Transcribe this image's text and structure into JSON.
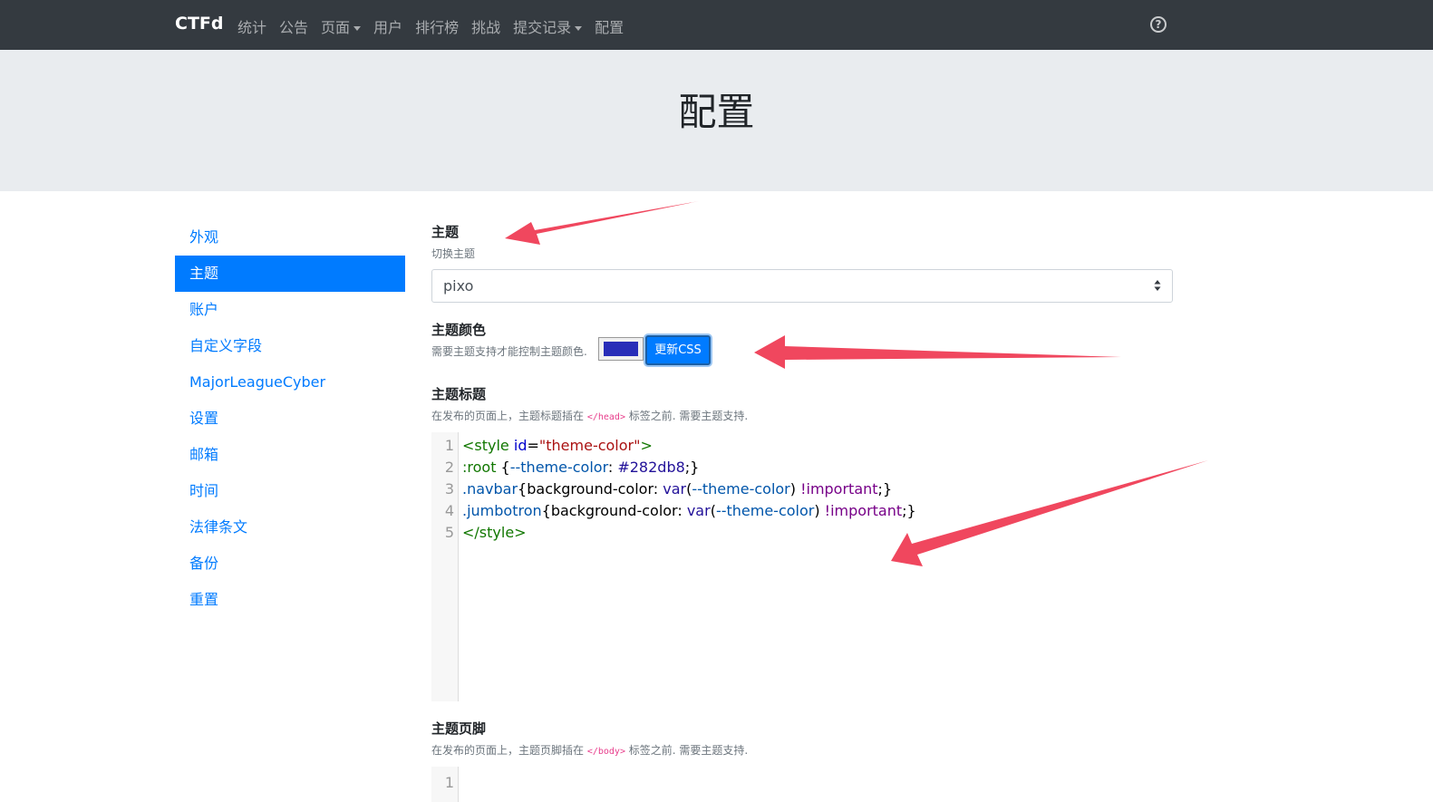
{
  "navbar": {
    "brand": "CTFd",
    "items": [
      {
        "label": "统计",
        "dropdown": false
      },
      {
        "label": "公告",
        "dropdown": false
      },
      {
        "label": "页面",
        "dropdown": true
      },
      {
        "label": "用户",
        "dropdown": false
      },
      {
        "label": "排行榜",
        "dropdown": false
      },
      {
        "label": "挑战",
        "dropdown": false
      },
      {
        "label": "提交记录",
        "dropdown": true
      },
      {
        "label": "配置",
        "dropdown": false
      }
    ],
    "help_icon": "question-circle-icon",
    "help_glyph": "?"
  },
  "jumbotron": {
    "title": "配置"
  },
  "sidebar": {
    "items": [
      {
        "label": "外观",
        "active": false
      },
      {
        "label": "主题",
        "active": true
      },
      {
        "label": "账户",
        "active": false
      },
      {
        "label": "自定义字段",
        "active": false
      },
      {
        "label": "MajorLeagueCyber",
        "active": false
      },
      {
        "label": "设置",
        "active": false
      },
      {
        "label": "邮箱",
        "active": false
      },
      {
        "label": "时间",
        "active": false
      },
      {
        "label": "法律条文",
        "active": false
      },
      {
        "label": "备份",
        "active": false
      },
      {
        "label": "重置",
        "active": false
      }
    ]
  },
  "theme": {
    "label": "主题",
    "help": "切换主题",
    "selected": "pixo"
  },
  "theme_color": {
    "label": "主题颜色",
    "help": "需要主题支持才能控制主题颜色.",
    "value": "#282db8",
    "button_label": "更新CSS"
  },
  "theme_header": {
    "label": "主题标题",
    "help_before": "在发布的页面上，主题标题插在 ",
    "help_code": "</head>",
    "help_after": " 标签之前. 需要主题支持.",
    "lines": [
      {
        "n": "1",
        "tokens": [
          [
            "t-tag",
            "<style"
          ],
          [
            "t-punct",
            " "
          ],
          [
            "t-attr",
            "id"
          ],
          [
            "t-punct",
            "="
          ],
          [
            "t-str",
            "\"theme-color\""
          ],
          [
            "t-tag",
            ">"
          ]
        ]
      },
      {
        "n": "2",
        "tokens": [
          [
            "t-tag",
            ":root"
          ],
          [
            "t-punct",
            " {"
          ],
          [
            "t-var",
            "--theme-color"
          ],
          [
            "t-punct",
            ": "
          ],
          [
            "t-atom",
            "#282db8"
          ],
          [
            "t-punct",
            ";}"
          ]
        ]
      },
      {
        "n": "3",
        "tokens": [
          [
            "t-prop",
            ".navbar"
          ],
          [
            "t-punct",
            "{background-color: "
          ],
          [
            "t-atom",
            "var"
          ],
          [
            "t-punct",
            "("
          ],
          [
            "t-var",
            "--theme-color"
          ],
          [
            "t-punct",
            ") "
          ],
          [
            "t-kw",
            "!important"
          ],
          [
            "t-punct",
            ";}"
          ]
        ]
      },
      {
        "n": "4",
        "tokens": [
          [
            "t-prop",
            ".jumbotron"
          ],
          [
            "t-punct",
            "{background-color: "
          ],
          [
            "t-atom",
            "var"
          ],
          [
            "t-punct",
            "("
          ],
          [
            "t-var",
            "--theme-color"
          ],
          [
            "t-punct",
            ") "
          ],
          [
            "t-kw",
            "!important"
          ],
          [
            "t-punct",
            ";}"
          ]
        ]
      },
      {
        "n": "5",
        "tokens": [
          [
            "t-tag",
            "</style>"
          ]
        ]
      }
    ]
  },
  "theme_footer": {
    "label": "主题页脚",
    "help_before": "在发布的页面上，主题页脚插在 ",
    "help_code": "</body>",
    "help_after": " 标签之前. 需要主题支持.",
    "lines": [
      {
        "n": "1",
        "tokens": []
      }
    ]
  },
  "colors": {
    "navbar_bg": "#343a40",
    "jumbotron_bg": "#e9ecef",
    "primary": "#007bff",
    "annotation_arrow": "#f0475e"
  }
}
